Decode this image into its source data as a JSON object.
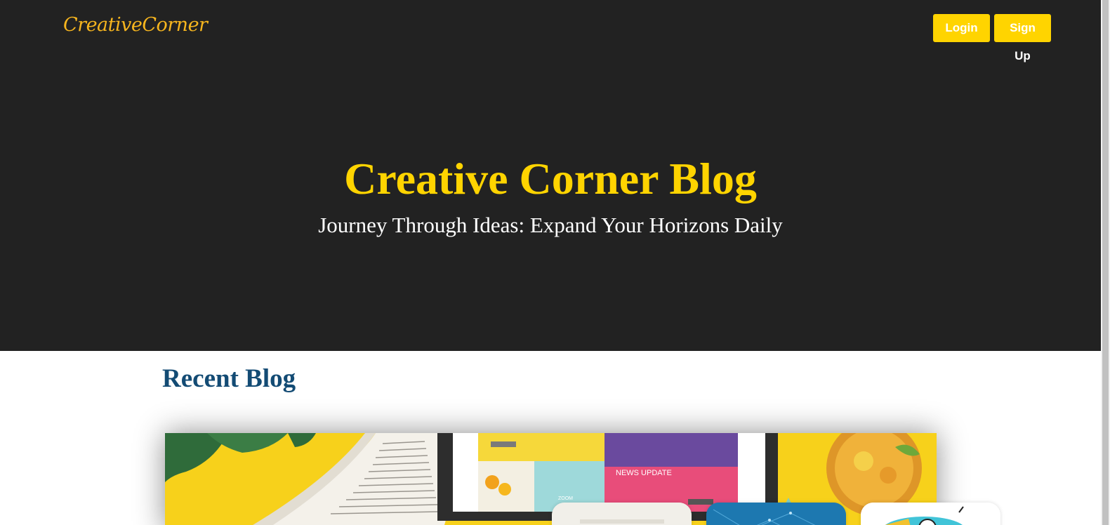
{
  "brand": {
    "logo_text": "CreativeCorner",
    "logo_color": "#f6b51e"
  },
  "nav": {
    "login_label": "Login",
    "signup_label": "Sign Up",
    "accent_color": "#ffd400"
  },
  "hero": {
    "title": "Creative Corner Blog",
    "subtitle": "Journey Through Ideas: Expand Your Horizons Daily",
    "background_color": "#222222",
    "title_color": "#ffd400"
  },
  "recent": {
    "section_title": "Recent Blog",
    "title_color": "#134b74",
    "featured_image_text": {
      "news_update": "NEWS UPDATE",
      "zoom": "ZOOM"
    }
  }
}
